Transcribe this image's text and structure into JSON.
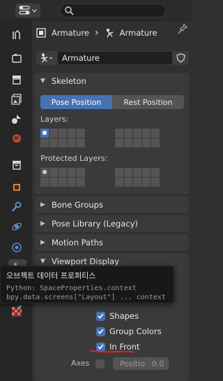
{
  "header": {
    "search_placeholder": ""
  },
  "breadcrumb": {
    "object_name": "Armature",
    "data_name": "Armature"
  },
  "datablock": {
    "name": "Armature"
  },
  "skeleton_panel": {
    "title": "Skeleton",
    "pose_position_label": "Pose Position",
    "rest_position_label": "Rest Position",
    "selected_position": "Pose Position",
    "layers_label": "Layers:",
    "protected_layers_label": "Protected Layers:"
  },
  "panels": {
    "bone_groups": "Bone Groups",
    "pose_library": "Pose Library (Legacy)",
    "motion_paths": "Motion Paths",
    "viewport_display": "Viewport Display"
  },
  "viewport_display": {
    "shapes_label": "Shapes",
    "shapes_checked": true,
    "group_colors_label": "Group Colors",
    "group_colors_checked": true,
    "in_front_label": "In Front",
    "in_front_checked": true,
    "axes_label": "Axes",
    "axes_checked": false,
    "position_label": "Positio",
    "position_value": "0.0"
  },
  "tooltip": {
    "title": "오브젝트 데이터 프로퍼티스",
    "python_line1": "Python: SpaceProperties.context",
    "python_line2": "bpy.data.screens[\"Layout\"] ... context"
  },
  "colors": {
    "accent": "#4772b3",
    "annotation": "#e0201c",
    "active_tab_icon": "#3ec5a0"
  }
}
